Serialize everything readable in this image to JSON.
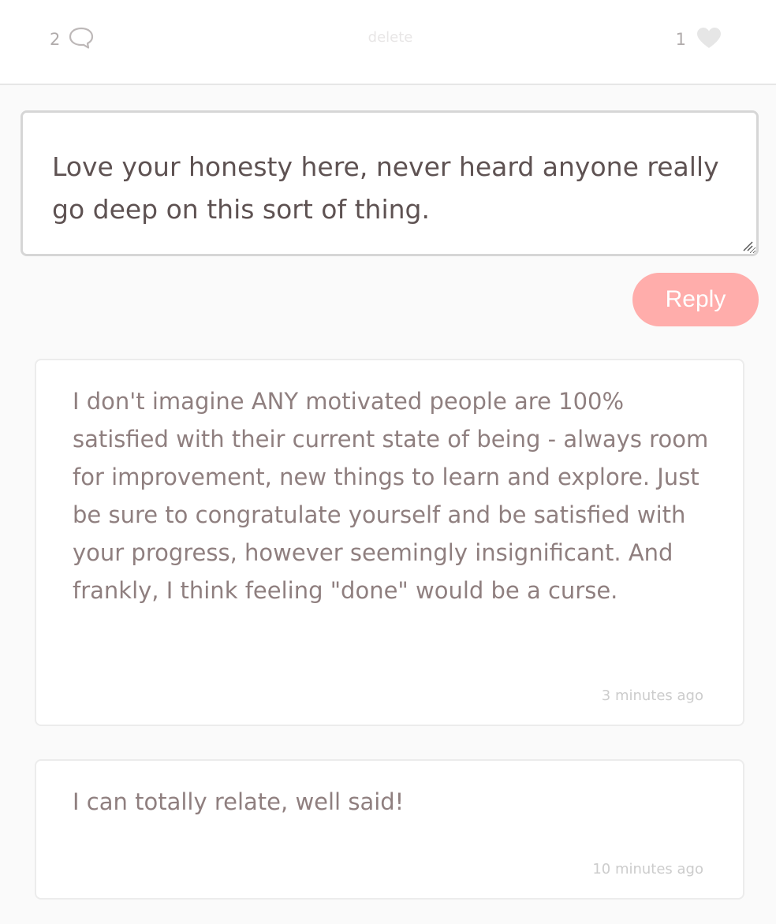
{
  "post_actions": {
    "comment_count": "2",
    "delete_label": "delete",
    "like_count": "1"
  },
  "reply_form": {
    "text": "Love your honesty here, never heard anyone really go deep on this sort of thing.",
    "submit_label": "Reply"
  },
  "comments": [
    {
      "text": "I don't imagine ANY motivated people are 100% satisfied with their current state of being - always room for improvement, new things to learn and explore. Just be sure to congratulate yourself and be satisfied with your progress, however seemingly insignificant. And frankly, I think feeling \"done\" would be a curse.",
      "time": "3 minutes ago"
    },
    {
      "text": "I can totally relate, well said!",
      "time": "10 minutes ago"
    }
  ],
  "colors": {
    "accent": "#ffadab",
    "comment_text": "#8f7f7f",
    "input_text": "#5e5252"
  }
}
